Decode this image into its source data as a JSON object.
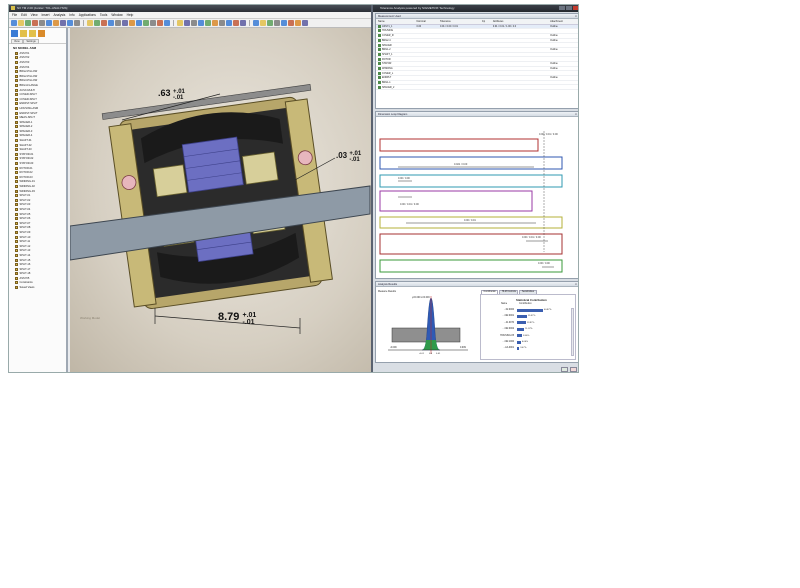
{
  "cad_window": {
    "title": "NX TM 2.00 [Juniter: TOL-ANALYSIS]",
    "menu": [
      "File",
      "Edit",
      "View",
      "Insert",
      "Analysis",
      "Info",
      "Applications",
      "Tools",
      "Window",
      "Help"
    ],
    "tree": {
      "tabs": [
        "View",
        "Settings"
      ],
      "root": "NX MODEL ASM",
      "items": [
        "ASSY01",
        "ASSY02",
        "ASSY03",
        "ASSY04",
        "BRG2-PILLOW",
        "BRG2-PILLOW",
        "BRG3-PILLOW",
        "BRG4-FLANGE",
        "ACSX-MULTI",
        "COVER-SPLIT",
        "COVER-SPLIT",
        "ENDPLT-SPLIT",
        "HOUSING-ASM",
        "ENDPLT-SPLIT",
        "MEAS-SPLIT",
        "SPACER-1",
        "SPACER-2",
        "SPACER-3",
        "SPACER-4",
        "SHAFT-01",
        "SHAFT-02",
        "SHAFT-03",
        "STATOR-01",
        "STATOR-02",
        "STATOR-03",
        "ROTOR-01",
        "ROTOR-02",
        "ROTOR-03",
        "WINDING-01",
        "WINDING-02",
        "WINDING-03",
        "SPLIT-01",
        "SPLIT-02",
        "SPLIT-03",
        "SPLIT-04",
        "SPLIT-05",
        "SPLIT-06",
        "SPLIT-07",
        "SPLIT-08",
        "SPLIT-09",
        "SPLIT-10",
        "SPLIT-11",
        "SPLIT-12",
        "SPLIT-13",
        "SPLIT-14",
        "SPLIT-15",
        "SPLIT-16",
        "SPLIT-17",
        "SPLIT-18",
        "ASSY05",
        "Constraints",
        "Saved Views"
      ]
    },
    "dimensions": {
      "d1": {
        "nominal": ".63",
        "upper": "+.01",
        "lower": "-.01"
      },
      "d2": {
        "nominal": ".03",
        "upper": "+.01",
        "lower": "-.01"
      },
      "d3": {
        "nominal": "8.79",
        "upper": "+.01",
        "lower": "-.01"
      }
    },
    "watermark": "Working Model"
  },
  "analysis_window": {
    "title": "Tolerance Analysis powered by SIGMETRIX Technology",
    "measurement": {
      "panel_title": "Measurement Used",
      "columns": [
        "Name",
        "Nominal",
        "Tolerance",
        "Cp",
        "Attributes",
        "",
        "Attachment"
      ],
      "rows": [
        {
          "name": "ASSY1_1",
          "nominal": "0.00",
          "tol": "0.01 / 0.00 / 0.01",
          "cp": "",
          "attr": "0.01 / 0.01 / 1.00 / 4.0",
          "att": "Outline"
        },
        {
          "name": "HOUSING",
          "nominal": "",
          "tol": "",
          "cp": "",
          "attr": "",
          "att": ""
        },
        {
          "name": "COVER_R",
          "nominal": "",
          "tol": "",
          "cp": "",
          "attr": "",
          "att": "Outline"
        },
        {
          "name": "BRG2-4",
          "nominal": "",
          "tol": "",
          "cp": "",
          "attr": "",
          "att": "Outline"
        },
        {
          "name": "SPACER",
          "nominal": "",
          "tol": "",
          "cp": "",
          "attr": "",
          "att": ""
        },
        {
          "name": "BRG1-2",
          "nominal": "",
          "tol": "",
          "cp": "",
          "attr": "",
          "att": "Outline"
        },
        {
          "name": "SHAFT_1",
          "nominal": "",
          "tol": "",
          "cp": "",
          "attr": "",
          "att": ""
        },
        {
          "name": "ROTOR",
          "nominal": "",
          "tol": "",
          "cp": "",
          "attr": "",
          "att": ""
        },
        {
          "name": "STATOR",
          "nominal": "",
          "tol": "",
          "cp": "",
          "attr": "",
          "att": "Outline"
        },
        {
          "name": "WINDING",
          "nominal": "",
          "tol": "",
          "cp": "",
          "attr": "",
          "att": "Outline"
        },
        {
          "name": "COVER_L",
          "nominal": "",
          "tol": "",
          "cp": "",
          "attr": "",
          "att": ""
        },
        {
          "name": "ENDPLT",
          "nominal": "",
          "tol": "",
          "cp": "",
          "attr": "",
          "att": "Outline"
        },
        {
          "name": "BRG1-1",
          "nominal": "",
          "tol": "",
          "cp": "",
          "attr": "",
          "att": ""
        },
        {
          "name": "SPACER_2",
          "nominal": "",
          "tol": "",
          "cp": "",
          "attr": "",
          "att": ""
        }
      ]
    },
    "loop": {
      "panel_title": "Dimension Loop Diagram",
      "labels": [
        "0.00 / 0.01 / 0.00",
        "0.021 / 0.00",
        "0.00 / 0.00",
        "0.00 / 0.01 / 0.00",
        "0.00 / 0.01",
        "0.00 / 0.01 / 0.00",
        "0.00 / 0.00"
      ]
    },
    "results": {
      "panel_title": "Analysis Results",
      "histogram_title": "Measure Results",
      "histogram_stats": "μ=0.000  σ=0.003",
      "axis_ticks": [
        "-0.009",
        "0.009"
      ],
      "bottom_ticks": [
        "-0.01",
        "0.0",
        "0.01"
      ],
      "tabs": [
        "Contribution",
        "HLM Controls",
        "Sensitivities"
      ],
      "contrib_title": "Statistical Contribution",
      "contrib_head": [
        "Name",
        "Contribution"
      ],
      "contributions": [
        {
          "name": "...02.0000",
          "value": 40.87
        },
        {
          "name": "...192.0001",
          "value": 15.57
        },
        {
          "name": "...41.0070",
          "value": 13.97
        },
        {
          "name": "...192.0002",
          "value": 11.37
        },
        {
          "name": "HOUSING.05",
          "value": 8.06
        },
        {
          "name": "...192.1000",
          "value": 6.06
        },
        {
          "name": "...AA.0001",
          "value": 3.47
        }
      ]
    }
  }
}
